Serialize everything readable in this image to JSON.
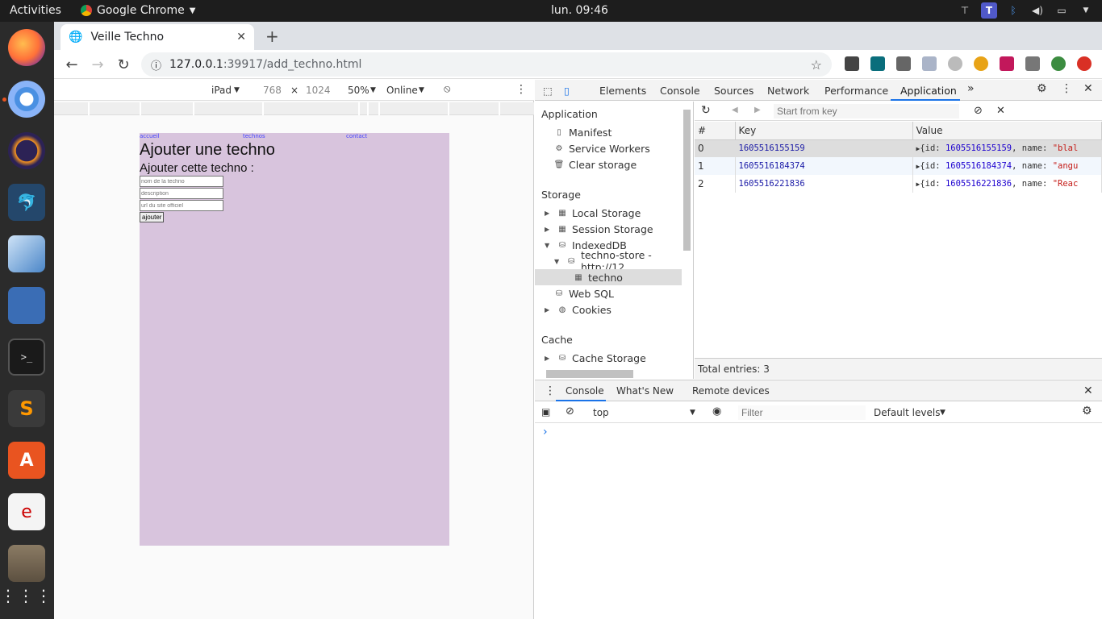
{
  "topbar": {
    "activities": "Activities",
    "app_name": "Google Chrome",
    "clock": "lun. 09:46"
  },
  "browser": {
    "tab_title": "Veille Techno",
    "url_host": "127.0.0.1",
    "url_path": ":39917/add_techno.html"
  },
  "device_toolbar": {
    "device": "iPad",
    "width": "768",
    "times": "×",
    "height": "1024",
    "zoom": "50%",
    "network": "Online"
  },
  "page": {
    "nav": [
      "accueil",
      "technos",
      "contact"
    ],
    "title": "Ajouter une techno",
    "subtitle": "Ajouter cette techno :",
    "placeholders": [
      "nom de la techno",
      "description",
      "url du site officiel"
    ],
    "button": "ajouter"
  },
  "devtools": {
    "tabs": [
      "Elements",
      "Console",
      "Sources",
      "Network",
      "Performance",
      "Application"
    ],
    "more": "»",
    "sidebar": {
      "application_header": "Application",
      "application_items": [
        "Manifest",
        "Service Workers",
        "Clear storage"
      ],
      "storage_header": "Storage",
      "storage_items": [
        "Local Storage",
        "Session Storage",
        "IndexedDB",
        "techno-store - http://12",
        "techno",
        "Web SQL",
        "Cookies"
      ],
      "cache_header": "Cache",
      "cache_items": [
        "Cache Storage"
      ]
    },
    "data": {
      "start_key_placeholder": "Start from key",
      "columns": [
        "#",
        "Key",
        "Value"
      ],
      "rows": [
        {
          "index": "0",
          "key": "1605516155159",
          "value_id": "1605516155159",
          "value_name": "\"blal"
        },
        {
          "index": "1",
          "key": "1605516184374",
          "value_id": "1605516184374",
          "value_name": "\"angu"
        },
        {
          "index": "2",
          "key": "1605516221836",
          "value_id": "1605516221836",
          "value_name": "\"Reac"
        }
      ],
      "total": "Total entries: 3"
    },
    "drawer": {
      "tabs": [
        "Console",
        "What's New",
        "Remote devices"
      ],
      "context": "top",
      "filter_placeholder": "Filter",
      "levels": "Default levels",
      "prompt": "›"
    }
  }
}
